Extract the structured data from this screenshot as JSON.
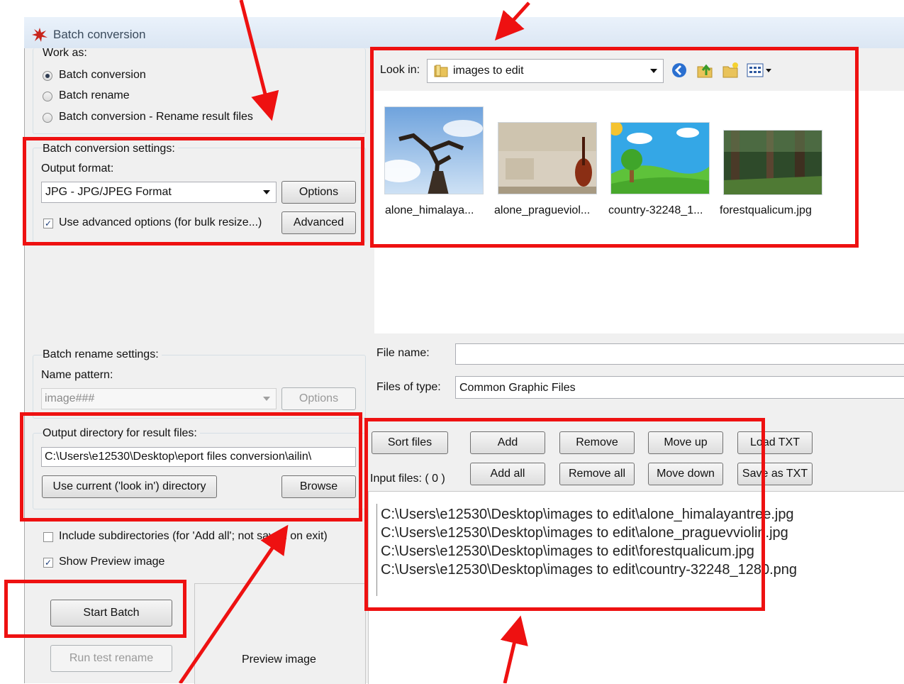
{
  "window": {
    "title": "Batch conversion"
  },
  "work_as": {
    "label": "Work as:",
    "options": [
      "Batch conversion",
      "Batch rename",
      "Batch conversion - Rename result files"
    ],
    "selected": 0
  },
  "conversion_settings": {
    "label": "Batch conversion settings:",
    "output_format_label": "Output format:",
    "output_format_value": "JPG - JPG/JPEG Format",
    "options_button": "Options",
    "advanced_checkbox": "Use advanced options (for bulk resize...)",
    "advanced_button": "Advanced"
  },
  "rename_settings": {
    "label": "Batch rename settings:",
    "name_pattern_label": "Name pattern:",
    "name_pattern_value": "image###",
    "options_button": "Options"
  },
  "output_directory": {
    "label": "Output directory for result files:",
    "path": "C:\\Users\\e12530\\Desktop\\eport files conversion\\ailin\\",
    "use_current_button": "Use current ('look in') directory",
    "browse_button": "Browse"
  },
  "checkboxes": {
    "include_subdirs": "Include subdirectories (for 'Add all'; not saved on exit)",
    "show_preview": "Show Preview image"
  },
  "actions": {
    "start_batch": "Start Batch",
    "run_test_rename": "Run test rename"
  },
  "preview": {
    "label": "Preview image"
  },
  "browser": {
    "look_in_label": "Look in:",
    "look_in_value": "images to edit",
    "files": [
      {
        "name": "alone_himalaya..."
      },
      {
        "name": "alone_pragueviol..."
      },
      {
        "name": "country-32248_1..."
      },
      {
        "name": "forestqualicum.jpg"
      }
    ],
    "file_name_label": "File name:",
    "file_name_value": "",
    "files_of_type_label": "Files of type:",
    "files_of_type_value": "Common Graphic Files"
  },
  "file_buttons": {
    "sort": "Sort files",
    "add": "Add",
    "remove": "Remove",
    "move_up": "Move up",
    "load_txt": "Load TXT",
    "add_all": "Add all",
    "remove_all": "Remove all",
    "move_down": "Move down",
    "save_txt": "Save as TXT"
  },
  "input_files": {
    "label": "Input files: ( 0 )",
    "items": [
      "C:\\Users\\e12530\\Desktop\\images to edit\\alone_himalayantree.jpg",
      "C:\\Users\\e12530\\Desktop\\images to edit\\alone_praguevviolin.jpg",
      "C:\\Users\\e12530\\Desktop\\images to edit\\forestqualicum.jpg",
      "C:\\Users\\e12530\\Desktop\\images to edit\\country-32248_1280.png"
    ]
  },
  "colors": {
    "annotation": "#ee1111",
    "panel": "#f0f0f0"
  }
}
